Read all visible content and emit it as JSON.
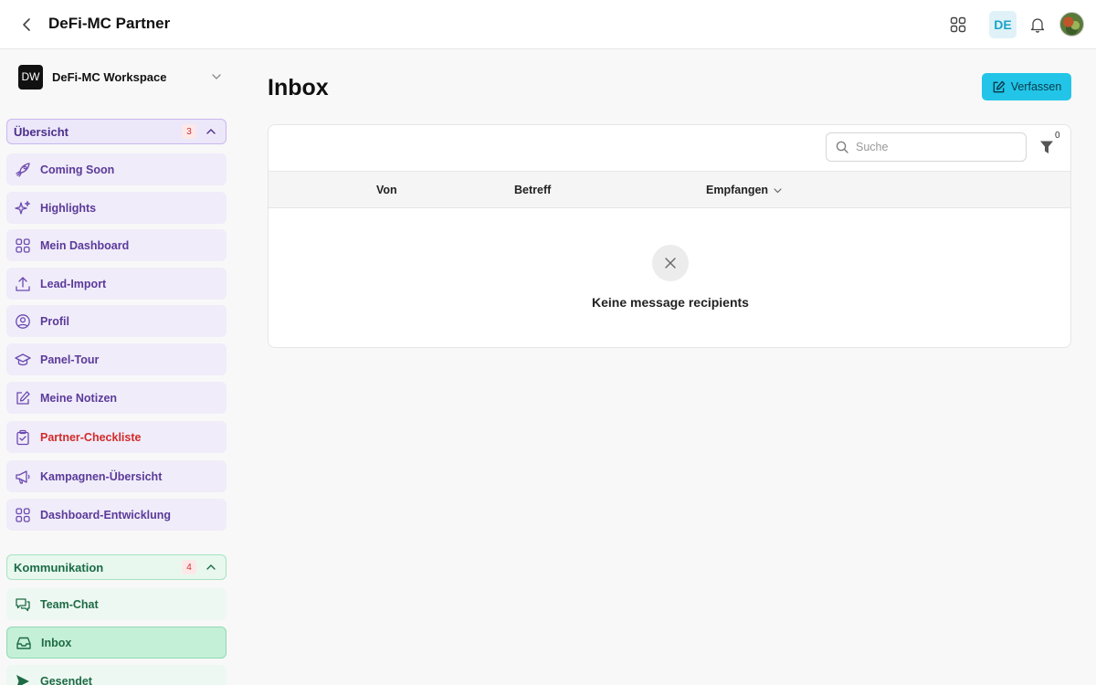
{
  "header": {
    "title": "DeFi-MC Partner",
    "language": "DE"
  },
  "workspace": {
    "logo": "DW",
    "name": "DeFi-MC Workspace"
  },
  "sections": {
    "overview": {
      "label": "Übersicht",
      "count": "3",
      "items": [
        {
          "label": "Coming Soon",
          "icon": "rocket-icon"
        },
        {
          "label": "Highlights",
          "icon": "sparkles-icon"
        },
        {
          "label": "Mein Dashboard",
          "icon": "grid-icon"
        },
        {
          "label": "Lead-Import",
          "icon": "upload-icon"
        },
        {
          "label": "Profil",
          "icon": "user-circle-icon"
        },
        {
          "label": "Panel-Tour",
          "icon": "graduation-cap-icon"
        },
        {
          "label": "Meine Notizen",
          "icon": "pencil-square-icon"
        },
        {
          "label": "Partner-Checkliste",
          "icon": "clipboard-check-icon"
        },
        {
          "label": "Kampagnen-Übersicht",
          "icon": "megaphone-icon"
        },
        {
          "label": "Dashboard-Entwicklung",
          "icon": "grid-icon"
        }
      ]
    },
    "communication": {
      "label": "Kommunikation",
      "count": "4",
      "items": [
        {
          "label": "Team-Chat",
          "icon": "chat-bubbles-icon"
        },
        {
          "label": "Inbox",
          "icon": "inbox-icon"
        },
        {
          "label": "Gesendet",
          "icon": "send-icon"
        }
      ]
    }
  },
  "main": {
    "title": "Inbox",
    "compose_label": "Verfassen",
    "search_placeholder": "Suche",
    "filter_count": "0",
    "columns": [
      "Von",
      "Betreff",
      "Empfangen"
    ],
    "empty_message": "Keine message recipients"
  },
  "colors": {
    "accent": "#22c5e8",
    "overview_section": "#ede7fa",
    "communication_section": "#e8f8ef",
    "active_item": "#c5f0d8"
  }
}
